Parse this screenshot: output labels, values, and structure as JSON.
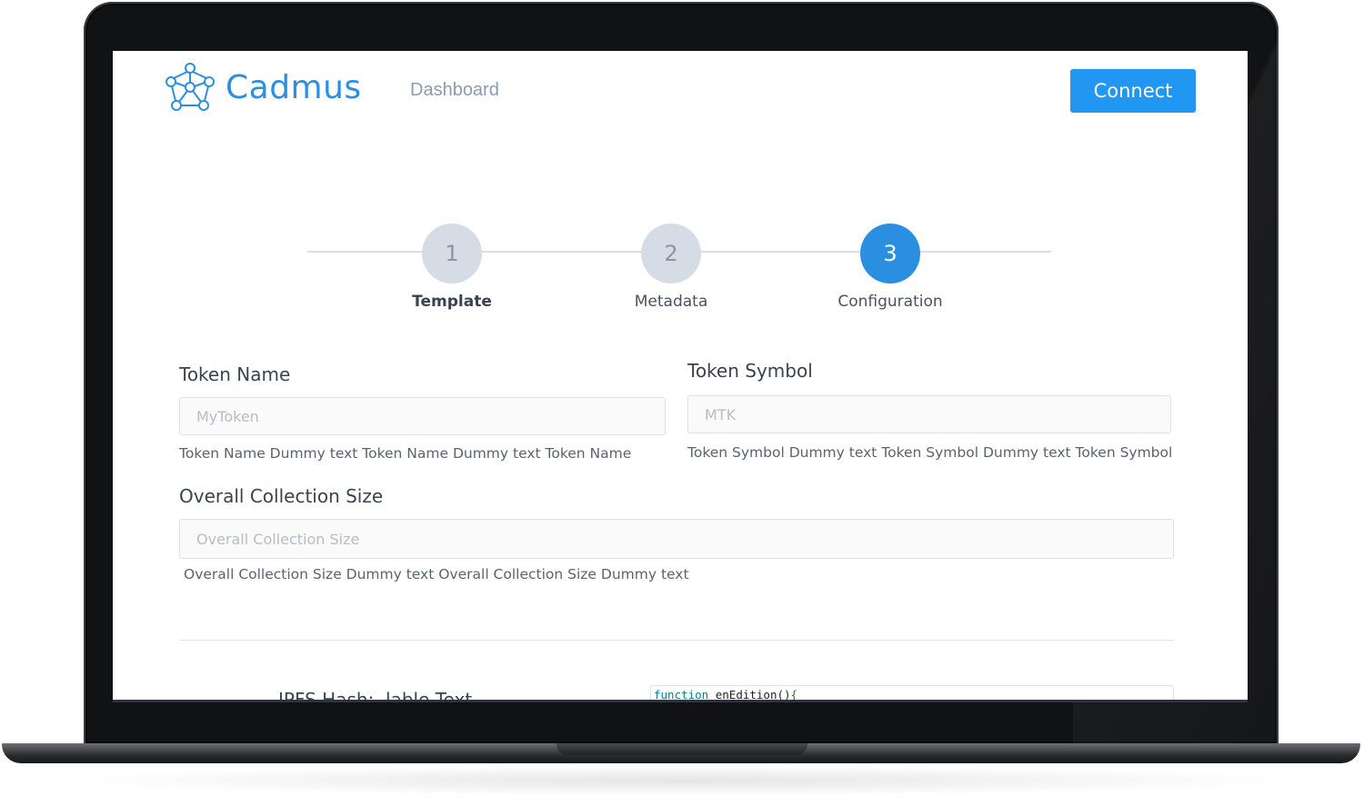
{
  "app": {
    "name": "Cadmus"
  },
  "nav": {
    "dashboard_label": "Dashboard"
  },
  "header": {
    "connect_label": "Connect"
  },
  "stepper": {
    "steps": [
      {
        "number": "1",
        "label": "Template"
      },
      {
        "number": "2",
        "label": "Metadata"
      },
      {
        "number": "3",
        "label": "Configuration"
      }
    ],
    "active_step": 3
  },
  "form": {
    "token_name": {
      "label": "Token Name",
      "placeholder": "MyToken",
      "value": "",
      "help": "Token Name Dummy text Token Name Dummy text Token Name"
    },
    "token_symbol": {
      "label": "Token Symbol",
      "placeholder": "MTK",
      "value": "",
      "help": "Token Symbol Dummy text Token Symbol  Dummy text Token Symbol"
    },
    "collection_size": {
      "label": "Overall Collection Size",
      "placeholder": "Overall Collection Size",
      "value": "",
      "help": "Overall Collection Size Dummy text Overall Collection Size Dummy text"
    },
    "ipfs": {
      "label": "IPFS Hash:",
      "value": "lable Text"
    },
    "code": {
      "keyword": "function",
      "name": " enEdition()",
      "brace": "{"
    }
  },
  "colors": {
    "accent": "#2196f3",
    "brand": "#2d8fe0",
    "step_inactive": "#d5dce5"
  },
  "icons": {
    "logo": "molecule-logo-icon"
  }
}
